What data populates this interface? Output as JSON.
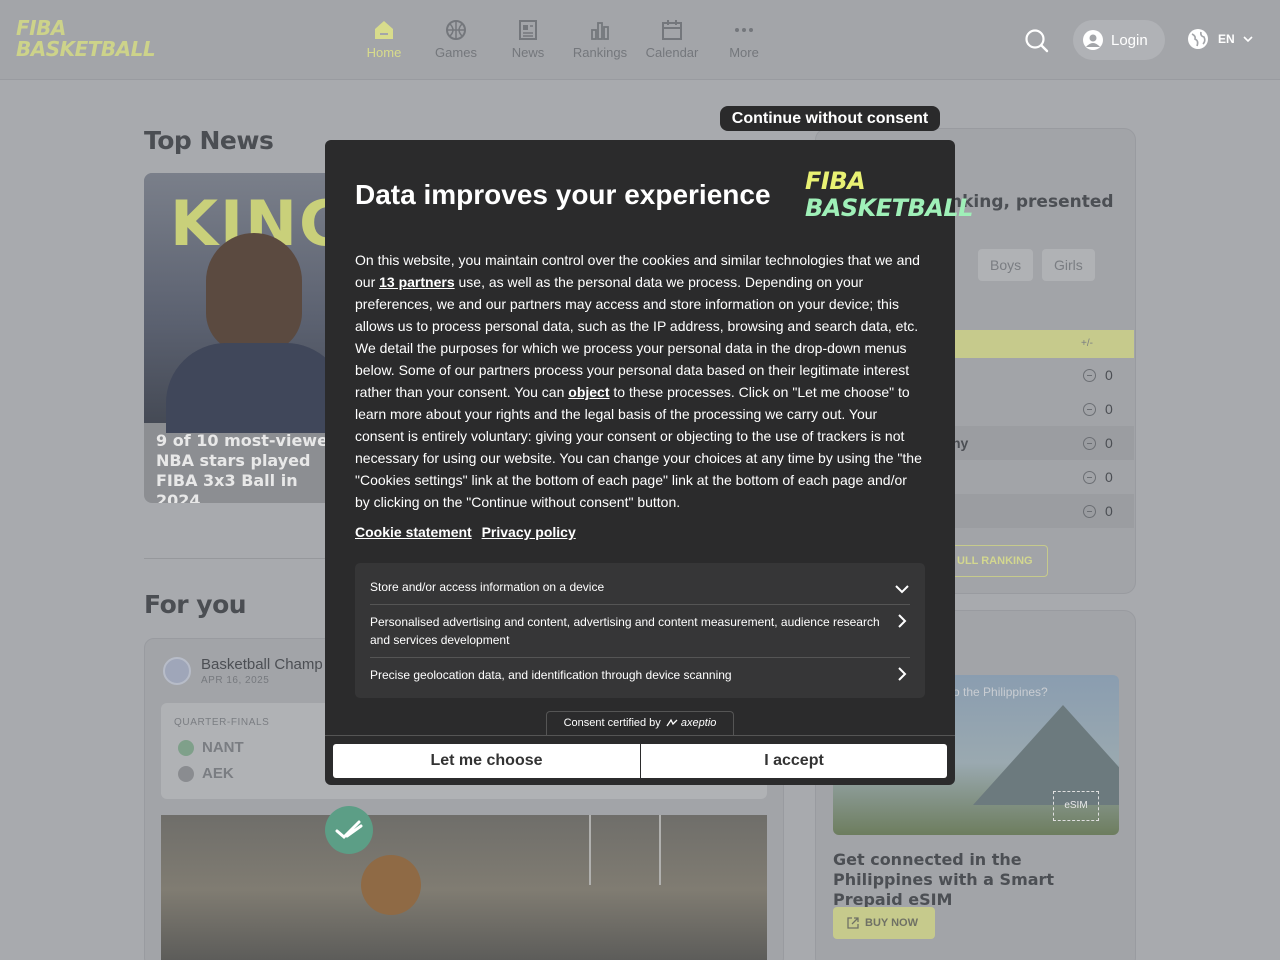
{
  "header": {
    "logo_line1": "FIBA",
    "logo_line2": "BASKETBALL",
    "nav": [
      {
        "label": "Home",
        "icon": "home-icon",
        "active": true
      },
      {
        "label": "Games",
        "icon": "basketball-icon",
        "active": false
      },
      {
        "label": "News",
        "icon": "newspaper-icon",
        "active": false
      },
      {
        "label": "Rankings",
        "icon": "bar-chart-icon",
        "active": false
      },
      {
        "label": "Calendar",
        "icon": "calendar-icon",
        "active": false
      },
      {
        "label": "More",
        "icon": "ellipsis-icon",
        "active": false
      }
    ],
    "login_label": "Login",
    "language": "EN"
  },
  "top_news": {
    "title": "Top News",
    "card_image_text": "KING",
    "card_caption": "9 of 10 most-viewed NBA stars played FIBA 3x3 Ball in 2024"
  },
  "for_you": {
    "title": "For you",
    "league_name": "Basketball Champ",
    "date": "APR 16, 2025",
    "round": "QUARTER-FINALS",
    "teams": [
      "NANT",
      "AEK"
    ]
  },
  "ranking": {
    "title": "nking, presented",
    "pills": [
      "n",
      "Boys",
      "Girls"
    ],
    "column_header": "+/-",
    "rows": [
      {
        "name": "",
        "value": "0"
      },
      {
        "name": "",
        "value": "0"
      },
      {
        "name": "ny",
        "value": "0"
      },
      {
        "name": "",
        "value": "0"
      },
      {
        "name": "",
        "value": "0"
      }
    ],
    "full_ranking_label": "ULL RANKING"
  },
  "ad": {
    "image_question": "o the Philippines?",
    "image_badge": "eSIM",
    "title": "Get connected in the Philippines with a Smart Prepaid eSIM",
    "buy_label": "BUY NOW"
  },
  "consent": {
    "continue_label": "Continue without consent",
    "title": "Data improves your experience",
    "logo_line1": "FIBA",
    "logo_line2": "BASKETBALL",
    "text_part1": "On this website, you maintain control over the cookies and similar technologies that we and our ",
    "partners_link": "13 partners",
    "text_part2": " use, as well as the personal data we process. Depending on your preferences, we and our partners may access and store information on your device; this allows us to process personal data, such as the IP address, browsing and search data, etc. We detail the purposes for which we process your personal data in the drop-down menus below. Some of our partners process your personal data based on their legitimate interest rather than your consent. You can ",
    "object_link": "object",
    "text_part3": " to these processes. Click on \"Let me choose\" to learn more about your rights and the legal basis of the processing we carry out. Your consent is entirely voluntary: giving your consent or objecting to the use of trackers is not necessary for using our website. You can change your choices at any time by using the \"the \"Cookies settings\" link at the bottom of each page\" link at the bottom of each page and/or by clicking on the \"Continue without consent\" button.",
    "cookie_statement": "Cookie statement",
    "privacy_policy": "Privacy policy",
    "purposes": [
      {
        "label": "Store and/or access information on a device",
        "icon": "chevron-down-icon"
      },
      {
        "label": "Personalised advertising and content, advertising and content measurement, audience research and services development",
        "icon": "chevron-right-icon"
      },
      {
        "label": "Precise geolocation data, and identification through device scanning",
        "icon": "chevron-right-icon"
      }
    ],
    "certified": "Consent certified by",
    "certified_brand": "axeptio",
    "let_me_choose": "Let me choose",
    "accept": "I accept"
  },
  "colors": {
    "accent": "#e9f173",
    "modal_bg": "#2b2b2c",
    "overlay_bg": "#a8aaae"
  }
}
